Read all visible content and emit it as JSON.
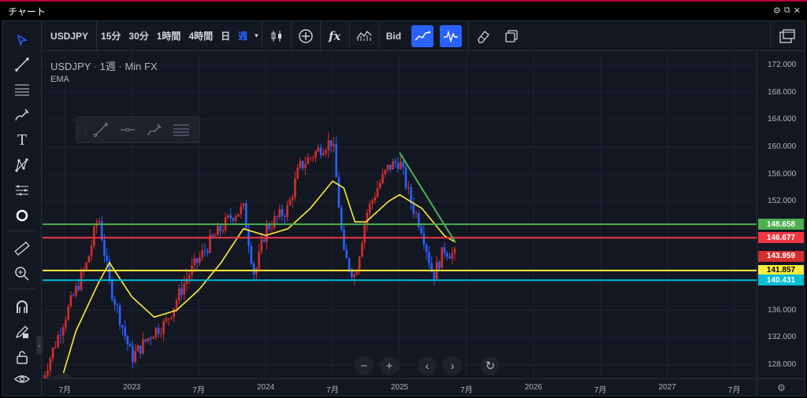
{
  "window": {
    "title": "チャート"
  },
  "toolbar": {
    "symbol": "USDJPY",
    "intervals": [
      "15分",
      "30分",
      "1時間",
      "4時間",
      "日",
      "週"
    ],
    "active_interval": "週",
    "bid_label": "Bid"
  },
  "legend": {
    "symbol": "USDJPY",
    "interval": "1週",
    "source": "Min FX",
    "indicator": "EMA"
  },
  "price_axis": {
    "ticks": [
      "172.000",
      "168.000",
      "164.000",
      "160.000",
      "156.000",
      "152.000",
      "140.000",
      "136.000",
      "132.000",
      "128.000"
    ],
    "line_labels": [
      {
        "text": "148.658",
        "color": "#4caf50"
      },
      {
        "text": "146.677",
        "color": "#f23645"
      },
      {
        "text": "143.959",
        "color": "#d32f2f"
      },
      {
        "text": "141.857",
        "color": "#ffeb3b"
      },
      {
        "text": "140.431",
        "color": "#00bcd4"
      }
    ]
  },
  "time_axis": {
    "labels": [
      "7月",
      "2023",
      "7月",
      "2024",
      "7月",
      "2025",
      "7月",
      "2026",
      "7月",
      "2027",
      "7月"
    ]
  },
  "chart_data": {
    "type": "candlestick",
    "symbol": "USDJPY",
    "interval": "1週",
    "ylim": [
      126,
      174
    ],
    "x_range": [
      "2022-05",
      "2027-09"
    ],
    "horizontal_lines": [
      {
        "price": 148.658,
        "color": "#4caf50"
      },
      {
        "price": 146.677,
        "color": "#f23645"
      },
      {
        "price": 141.857,
        "color": "#ffeb3b"
      },
      {
        "price": 140.431,
        "color": "#00bcd4"
      }
    ],
    "last_price": 143.959,
    "trendline": {
      "from": [
        "2025-01",
        159.2
      ],
      "to": [
        "2025-06",
        146.0
      ],
      "color": "#4caf50"
    },
    "price_path": [
      [
        "2022-05",
        126
      ],
      [
        "2022-07",
        135
      ],
      [
        "2022-09",
        143
      ],
      [
        "2022-10",
        150
      ],
      [
        "2022-11",
        140
      ],
      [
        "2023-01",
        129
      ],
      [
        "2023-03",
        133
      ],
      [
        "2023-04",
        134
      ],
      [
        "2023-06",
        141
      ],
      [
        "2023-08",
        146
      ],
      [
        "2023-10",
        150
      ],
      [
        "2023-11",
        151
      ],
      [
        "2023-12",
        141
      ],
      [
        "2024-01",
        148
      ],
      [
        "2024-03",
        151
      ],
      [
        "2024-04",
        157
      ],
      [
        "2024-06",
        160
      ],
      [
        "2024-07",
        161
      ],
      [
        "2024-08",
        144
      ],
      [
        "2024-09",
        141
      ],
      [
        "2024-10",
        150
      ],
      [
        "2024-11",
        154
      ],
      [
        "2024-12",
        157
      ],
      [
        "2025-01",
        158
      ],
      [
        "2025-02",
        152
      ],
      [
        "2025-03",
        148
      ],
      [
        "2025-04",
        141
      ],
      [
        "2025-05",
        145
      ],
      [
        "2025-06",
        144
      ]
    ],
    "ema_path": [
      [
        "2022-06",
        122
      ],
      [
        "2022-08",
        133
      ],
      [
        "2022-10",
        140
      ],
      [
        "2022-11",
        143
      ],
      [
        "2023-01",
        138
      ],
      [
        "2023-03",
        135
      ],
      [
        "2023-05",
        136
      ],
      [
        "2023-07",
        139
      ],
      [
        "2023-09",
        143
      ],
      [
        "2023-11",
        148
      ],
      [
        "2024-01",
        147
      ],
      [
        "2024-03",
        148
      ],
      [
        "2024-05",
        151
      ],
      [
        "2024-07",
        155
      ],
      [
        "2024-08",
        154
      ],
      [
        "2024-09",
        149
      ],
      [
        "2024-10",
        149
      ],
      [
        "2024-12",
        152
      ],
      [
        "2025-01",
        153
      ],
      [
        "2025-03",
        151
      ],
      [
        "2025-05",
        147
      ],
      [
        "2025-06",
        146
      ]
    ]
  },
  "colors": {
    "background": "#131722",
    "grid": "#1f2330",
    "up": "#d32f2f",
    "down": "#2962ff",
    "ema": "#ffeb3b",
    "accent": "#2962ff"
  },
  "icons": {
    "left_toolbar": [
      "cursor-icon",
      "trendline-icon",
      "fib-icon",
      "brush-icon",
      "text-icon",
      "pattern-icon",
      "projection-icon",
      "circle-icon",
      "ruler-icon",
      "zoom-icon",
      "magnet-icon",
      "lock-pencil-icon",
      "lock-icon",
      "eye-icon"
    ]
  }
}
